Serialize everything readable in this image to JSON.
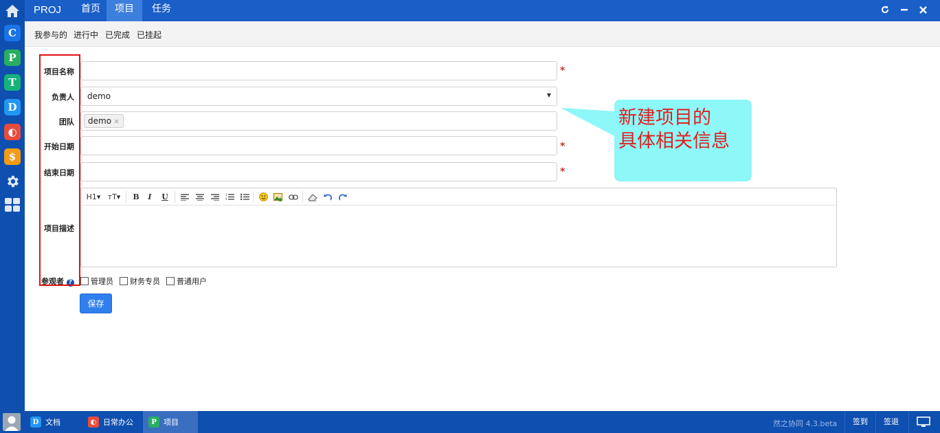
{
  "topbar": {
    "brand": "PROJ",
    "nav": [
      {
        "label": "首页"
      },
      {
        "label": "项目"
      },
      {
        "label": "任务"
      }
    ]
  },
  "subnav": [
    "我参与的",
    "进行中",
    "已完成",
    "已挂起"
  ],
  "rail": {
    "apps": [
      {
        "glyph": "C",
        "color": "#1a73e8"
      },
      {
        "glyph": "P",
        "color": "#27ae60"
      },
      {
        "glyph": "T",
        "color": "#16b27a"
      },
      {
        "glyph": "D",
        "color": "#2196f3"
      },
      {
        "glyph": "◐",
        "color": "#e74c3c"
      },
      {
        "glyph": "$",
        "color": "#f39c12"
      }
    ]
  },
  "form": {
    "name_label": "项目名称",
    "owner_label": "负责人",
    "owner_value": "demo",
    "team_label": "团队",
    "team_tag": "demo",
    "start_label": "开始日期",
    "end_label": "结束日期",
    "desc_label": "项目描述",
    "viewers_label": "参观者",
    "required_mark": "*",
    "viewer_options": [
      "管理员",
      "财务专员",
      "普通用户"
    ],
    "save_label": "保存"
  },
  "editor": {
    "toolbar": [
      "H1",
      "тT",
      "B",
      "I",
      "U",
      "align-left",
      "align-center",
      "align-right",
      "ordered-list",
      "unordered-list",
      "emoji",
      "image",
      "link",
      "eraser",
      "undo",
      "redo"
    ]
  },
  "callout": {
    "line1": "新建项目的",
    "line2": "具体相关信息"
  },
  "taskbar": {
    "tasks": [
      {
        "label": "文档",
        "glyph": "D",
        "color": "#2196f3"
      },
      {
        "label": "日常办公",
        "glyph": "◐",
        "color": "#e74c3c"
      },
      {
        "label": "项目",
        "glyph": "P",
        "color": "#27ae60"
      }
    ],
    "version": "然之协同 4.3.beta",
    "sign_in": "签到",
    "sign_out": "签退"
  }
}
